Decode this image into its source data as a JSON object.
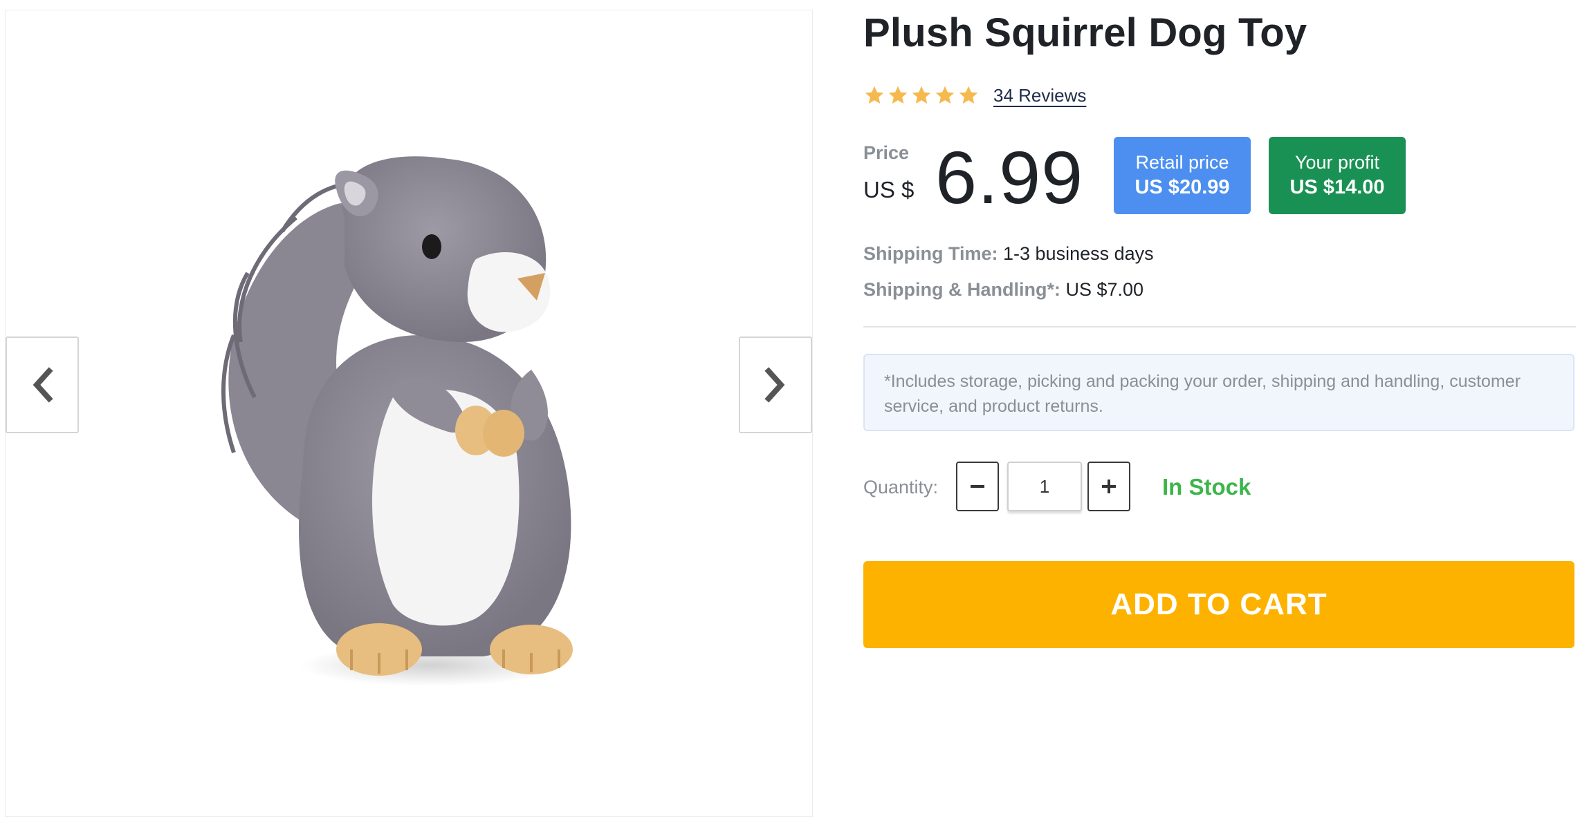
{
  "product": {
    "title": "Plush Squirrel Dog Toy",
    "rating": 5,
    "rating_max": 5,
    "reviews_label": "34 Reviews"
  },
  "gallery": {
    "image_subject": "plush gray squirrel toy",
    "prev_icon": "chevron-left-icon",
    "next_icon": "chevron-right-icon"
  },
  "pricing": {
    "price_label": "Price",
    "currency": "US $",
    "price": "6.99",
    "retail_label": "Retail price",
    "retail_value": "US $20.99",
    "profit_label": "Your profit",
    "profit_value": "US $14.00"
  },
  "shipping": {
    "time_label": "Shipping Time:",
    "time_value": "1-3 business days",
    "handling_label": "Shipping & Handling*:",
    "handling_value": "US $7.00"
  },
  "note": "*Includes storage, picking and packing your order, shipping and handling, customer service, and product returns.",
  "quantity": {
    "label": "Quantity:",
    "value": "1"
  },
  "stock_status": "In Stock",
  "cart_button": "ADD TO CART",
  "colors": {
    "star": "#f5b94d",
    "retail_badge": "#4c8ff0",
    "profit_badge": "#1a9154",
    "in_stock": "#3cb54a",
    "cart_button": "#feb200",
    "note_bg": "#f1f6fd"
  }
}
